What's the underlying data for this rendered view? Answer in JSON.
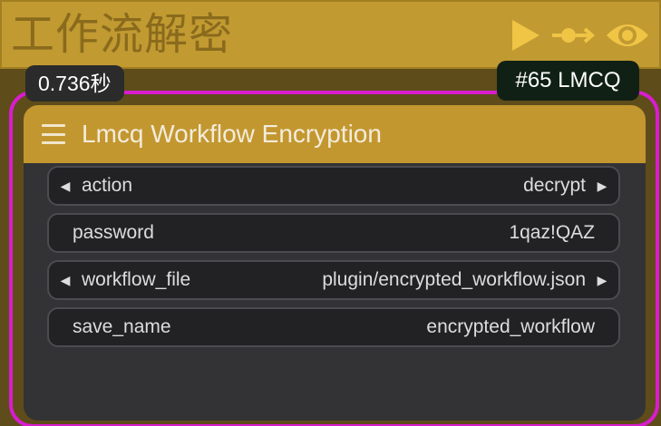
{
  "group": {
    "title": "工作流解密",
    "icons": [
      "play-icon",
      "pin-icon",
      "eye-icon"
    ]
  },
  "badges": {
    "time": "0.736秒",
    "id": "#65 LMCQ"
  },
  "node": {
    "title": "Lmcq Workflow Encryption",
    "widgets": [
      {
        "label": "action",
        "value": "decrypt",
        "type": "combo"
      },
      {
        "label": "password",
        "value": "1qaz!QAZ",
        "type": "text"
      },
      {
        "label": "workflow_file",
        "value": "plugin/encrypted_workflow.json",
        "type": "combo"
      },
      {
        "label": "save_name",
        "value": "encrypted_workflow",
        "type": "text"
      }
    ]
  },
  "colors": {
    "group_header": "#c19a32",
    "group_body": "#5e4c1a",
    "node_title": "#c3972f",
    "node_body": "#333336",
    "selection_outline": "#d91cce",
    "id_badge": "#102015"
  }
}
